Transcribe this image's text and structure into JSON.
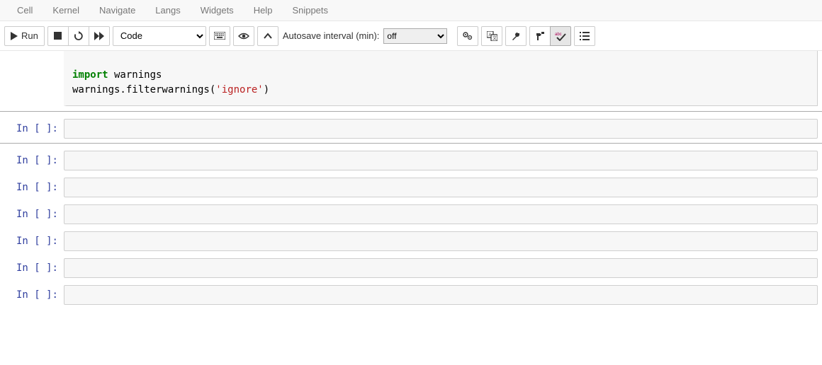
{
  "menu": {
    "items": [
      "Cell",
      "Kernel",
      "Navigate",
      "Langs",
      "Widgets",
      "Help",
      "Snippets"
    ]
  },
  "toolbar": {
    "run_label": "Run",
    "cell_type_selected": "Code",
    "autosave_label": "Autosave interval (min):",
    "autosave_selected": "off"
  },
  "code_cell": {
    "line_gap": "",
    "line1_kw": "import",
    "line1_rest": " warnings",
    "line2_pre": "warnings.filterwarnings(",
    "line2_str": "'ignore'",
    "line2_post": ")"
  },
  "prompts": {
    "empty": "In [ ]:"
  },
  "empty_cell_count": 7
}
